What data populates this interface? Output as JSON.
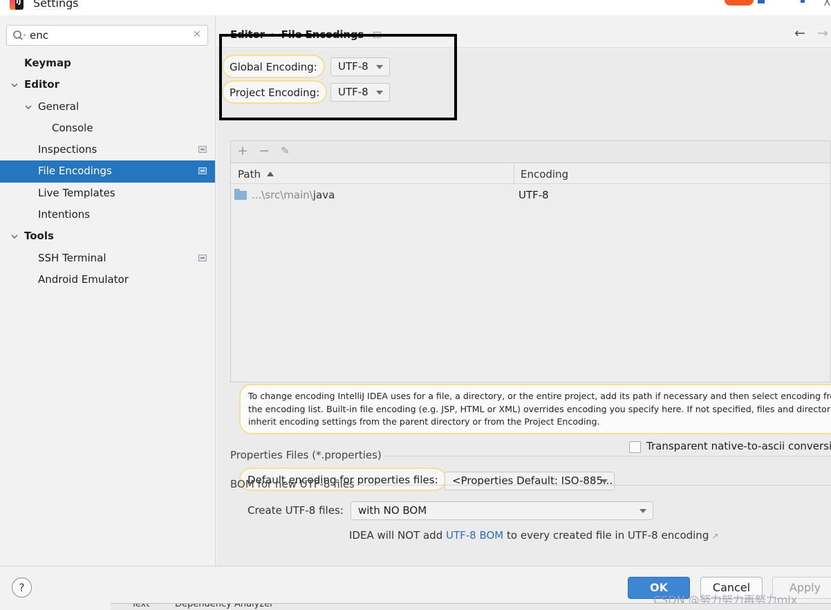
{
  "window": {
    "title": "Settings",
    "logo_text": "IJ",
    "close_glyph": "╳"
  },
  "sidebar": {
    "search": {
      "value": "enc",
      "placeholder": ""
    },
    "items": [
      {
        "label": "Keymap"
      },
      {
        "label": "Editor"
      },
      {
        "label": "General"
      },
      {
        "label": "Console"
      },
      {
        "label": "Inspections"
      },
      {
        "label": "File Encodings"
      },
      {
        "label": "Live Templates"
      },
      {
        "label": "Intentions"
      },
      {
        "label": "Tools"
      },
      {
        "label": "SSH Terminal"
      },
      {
        "label": "Android Emulator"
      }
    ]
  },
  "breadcrumb": {
    "parent": "Editor",
    "separator": "›",
    "current": "File Encodings"
  },
  "encoding": {
    "global_label": "Global Encoding:",
    "global_value": "UTF-8",
    "project_label": "Project Encoding:",
    "project_value": "UTF-8"
  },
  "table": {
    "columns": {
      "path": "Path",
      "encoding": "Encoding"
    },
    "rows": [
      {
        "path_prefix": "...\\src\\main\\",
        "path_name": "java",
        "encoding": "UTF-8"
      }
    ]
  },
  "info_text": [
    "To change encoding IntelliJ IDEA uses for a file, a directory, or the entire project, add its path if necessary and then select encoding from",
    "the encoding list. Built-in file encoding (e.g. JSP, HTML or XML) overrides encoding you specify here. If not specified, files and directories",
    "inherit encoding settings from the parent directory or from the Project Encoding."
  ],
  "properties": {
    "section_title": "Properties Files (*.properties)",
    "default_label": "Default encoding for properties files:",
    "default_value": "<Properties Default: ISO-885...",
    "transparent_label": "Transparent native-to-ascii conversion",
    "transparent_checked": false
  },
  "bom": {
    "section_title": "BOM for new UTF-8 files",
    "create_label": "Create UTF-8 files:",
    "create_value": "with NO BOM",
    "note_before": "IDEA will NOT add ",
    "note_link": "UTF-8 BOM",
    "note_after": " to every created file in UTF-8 encoding"
  },
  "buttons": {
    "help": "?",
    "ok": "OK",
    "cancel": "Cancel",
    "apply": "Apply"
  },
  "underlying_window": {
    "tab1": "Text",
    "tab2": "Dependency Analyzer"
  },
  "watermark": "CSDN @努力努力再努力mlx",
  "colors": {
    "selection": "#2675bf",
    "ok_button": "#3d86d3",
    "hint_border": "#f4df93",
    "link": "#2f6fb3"
  }
}
